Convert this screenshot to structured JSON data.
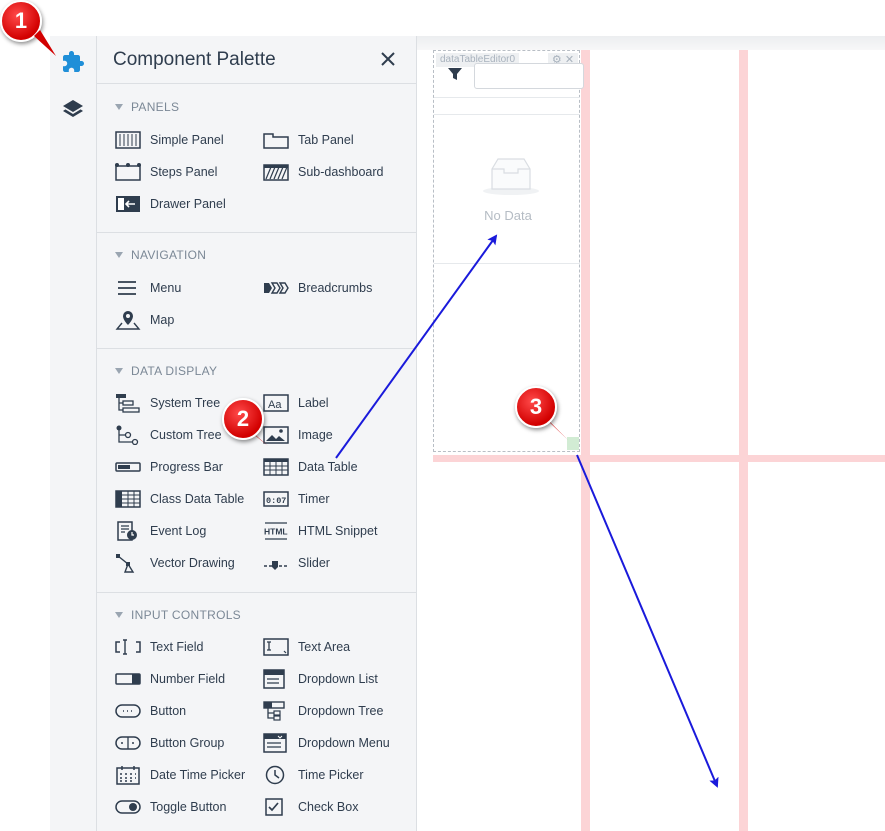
{
  "palette": {
    "title": "Component Palette",
    "sections": {
      "panels": {
        "title": "PANELS",
        "items": [
          "Simple Panel",
          "Tab Panel",
          "Steps Panel",
          "Sub-dashboard",
          "Drawer Panel"
        ]
      },
      "navigation": {
        "title": "NAVIGATION",
        "items": [
          "Menu",
          "Breadcrumbs",
          "Map"
        ]
      },
      "data_display": {
        "title": "DATA DISPLAY",
        "items": [
          "System Tree",
          "Label",
          "Custom Tree",
          "Image",
          "Progress Bar",
          "Data Table",
          "Class Data Table",
          "Timer",
          "Event Log",
          "HTML Snippet",
          "Vector Drawing",
          "Slider"
        ]
      },
      "input_controls": {
        "title": "INPUT CONTROLS",
        "items": [
          "Text Field",
          "Text Area",
          "Number Field",
          "Dropdown List",
          "Button",
          "Dropdown Tree",
          "Button Group",
          "Dropdown Menu",
          "Date Time Picker",
          "Time Picker",
          "Toggle Button",
          "Check Box"
        ]
      }
    }
  },
  "canvas": {
    "widget_tag": "dataTableEditor0",
    "widget_tools": "⚙ ✕",
    "empty_text": "No Data"
  },
  "annotations": {
    "badges": [
      "1",
      "2",
      "3"
    ],
    "arrow_color": "#1a1adb",
    "badge_color": "#e00000"
  },
  "colors": {
    "accent_icon": "#1f8fd8",
    "text": "#2f3d4e",
    "section_title": "#7b8896",
    "guide": "#fcd4d6"
  }
}
